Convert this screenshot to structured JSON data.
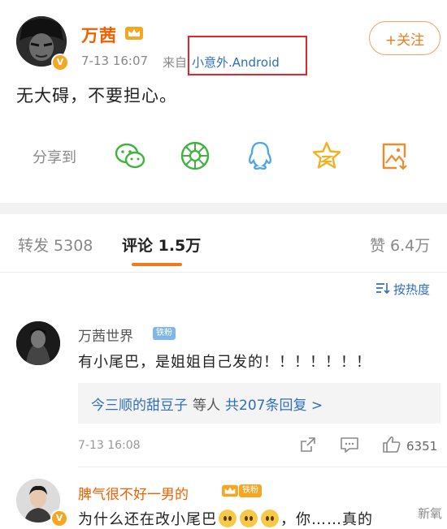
{
  "post": {
    "author": "万茜",
    "time": "7-13 16:07",
    "source_prefix": "来自",
    "source": "小意外.Android",
    "follow_label": "+关注",
    "text": "无大碍，不要担心。"
  },
  "share": {
    "label": "分享到",
    "icons": [
      "wechat-icon",
      "moments-icon",
      "qq-icon",
      "qzone-icon",
      "save-image-icon"
    ]
  },
  "tabs": {
    "repost": "转发 5308",
    "comments": "评论 1.5万",
    "likes": "赞 6.4万"
  },
  "sort_label": "按热度",
  "comments": [
    {
      "name": "万茜世界",
      "badge": "铁粉",
      "text": "有小尾巴，是姐姐自己发的！！！！！！！",
      "reply_names": "今三顺的甜豆子",
      "reply_mid": "等人",
      "reply_count": "共207条回复 >",
      "time": "7-13 16:08",
      "likes": "6351"
    },
    {
      "name": "脾气很不好一男的",
      "badge": "铁粉",
      "text_start": "为什么还在改小尾巴",
      "text_end": "，你……真的"
    }
  ],
  "watermark": "新氧",
  "colors": {
    "orange": "#f07a1d",
    "link_blue": "#2f6fb8",
    "highlight_red": "#e4262a"
  }
}
